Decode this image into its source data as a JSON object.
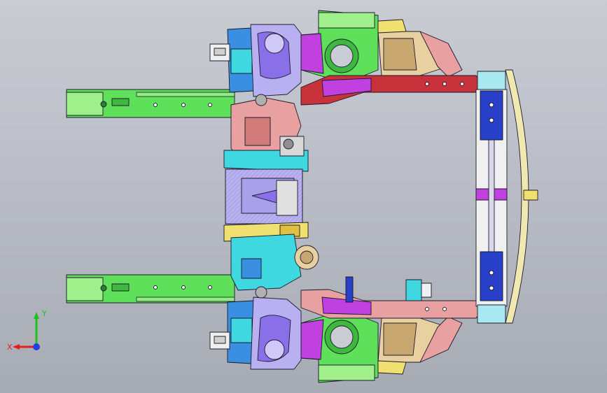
{
  "viewport": {
    "background_top": "#c9ccd3",
    "background_bottom": "#a7abb4"
  },
  "model": {
    "description_icon": "car-body-front-subframe-assembly",
    "colors": {
      "green": "#5fe05a",
      "light_green": "#9ff08a",
      "blue": "#3a8fe0",
      "cyan": "#40d8e0",
      "red": "#c8323a",
      "pink": "#e8a0a0",
      "magenta": "#c040e0",
      "purple": "#8a70e8",
      "lavender": "#b8b0f0",
      "yellow": "#f0e070",
      "tan": "#e8d0a0",
      "navy": "#2840c8",
      "white": "#f0f0f0",
      "outline": "#1a1a2a"
    }
  },
  "triad": {
    "x_label": "X",
    "y_label": "Y",
    "x_color": "#e02020",
    "y_color": "#20c020",
    "z_color": "#2040e0"
  }
}
